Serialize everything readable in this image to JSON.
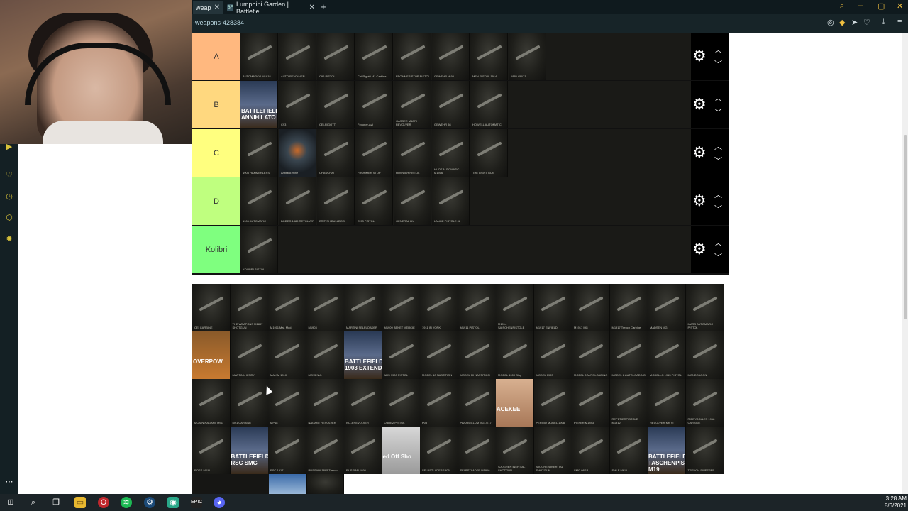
{
  "browser": {
    "tabs": [
      {
        "label": "weap",
        "close": "✕"
      },
      {
        "label": "Lumphini Garden | Battlefie",
        "close": "✕",
        "favicon": "BF"
      }
    ],
    "new_tab": "+",
    "url": "-weapons-428384"
  },
  "tiers": [
    {
      "label": "A",
      "color": "#ffb87f",
      "items": [
        {
          "tag": "AUTOMATICO M1918"
        },
        {
          "tag": "AUTO REVOLVER"
        },
        {
          "tag": "C96 PISTOL"
        },
        {
          "tag": "Cei-Rigotti M1 Carbine"
        },
        {
          "tag": "FROMMER STOP PISTOL"
        },
        {
          "tag": "GEWEHR M.95"
        },
        {
          "tag": "MEN-PISTOL 1914"
        },
        {
          "tag": "1885 GR/71"
        }
      ]
    },
    {
      "label": "B",
      "color": "#ffd87f",
      "items": [
        {
          "tag": "",
          "special": "BATTLEFIELD ANNIHILATO"
        },
        {
          "tag": "C93"
        },
        {
          "tag": "CEI-RIGOTTI"
        },
        {
          "tag": "Fedorov-Avt"
        },
        {
          "tag": "GASSER M1870 REVOLVER"
        },
        {
          "tag": "GEWEHR 98"
        },
        {
          "tag": "HOWELL AUTOMATIC"
        }
      ]
    },
    {
      "label": "C",
      "color": "#ffff7f",
      "items": [
        {
          "tag": "1903 HAMMERLESS"
        },
        {
          "tag": "Antitank mine"
        },
        {
          "tag": "CHAUCHAT"
        },
        {
          "tag": "FROMMER STOP"
        },
        {
          "tag": "HOWDAH PISTOL"
        },
        {
          "tag": "HUOT AUTOMATIC M1916"
        },
        {
          "tag": "THE LIGHT GUN"
        }
      ]
    },
    {
      "label": "D",
      "color": "#bfff7f",
      "items": [
        {
          "tag": "1906 AUTOMATIC"
        },
        {
          "tag": "BODEO 1889 REVOLVER"
        },
        {
          "tag": "BRITISH BULLDOG"
        },
        {
          "tag": "C-93 PISTOL"
        },
        {
          "tag": "GENERAL LIU"
        },
        {
          "tag": "LANGE PISTOLE 08"
        }
      ]
    },
    {
      "label": "Kolibri",
      "color": "#7fff7f",
      "items": [
        {
          "tag": "KOLIBRI PISTOL"
        }
      ]
    }
  ],
  "pool": {
    "rows": [
      [
        {
          "tag": "CEI CARBINE"
        },
        {
          "tag": "THE WEAPONS M1897 SHOTGUN"
        },
        {
          "tag": "M1911 Mal. Mod."
        },
        {
          "tag": "M1903"
        },
        {
          "tag": "MARTINI SELFLOADER"
        },
        {
          "tag": "M1909 BENET MERCIE"
        },
        {
          "tag": "1911 IN YORK"
        },
        {
          "tag": "M1911 PISTOL"
        },
        {
          "tag": "M1914 SAISCHENPISTOLE"
        },
        {
          "tag": "M1917 ENFIELD"
        },
        {
          "tag": "M1917 MG"
        },
        {
          "tag": "M1917 Trench Carbine"
        },
        {
          "tag": "MADSEN MG"
        },
        {
          "tag": "MARS AUTOMATIC PISTOL"
        }
      ],
      [
        {
          "tag": "",
          "special": "OVERPOW"
        },
        {
          "tag": "MARTINI-HENRY"
        },
        {
          "tag": "MAXIM 1910"
        },
        {
          "tag": "MG15 N.A."
        },
        {
          "tag": "",
          "special": "BATTLEFIELD 1903 EXTEND"
        },
        {
          "tag": "ARS 1900 PISTOL"
        },
        {
          "tag": "MODEL 10 NASTITION"
        },
        {
          "tag": "MODEL 10 NASTITION"
        },
        {
          "tag": "MODEL 1900 Slug"
        },
        {
          "tag": "MODEL 1903"
        },
        {
          "tag": "MODEL 8 AUTOLOADING"
        },
        {
          "tag": "MODEL 8 AUTOLOADING"
        },
        {
          "tag": "MODELLO 1915 PISTOL"
        },
        {
          "tag": "MONDRAGON"
        }
      ],
      [
        {
          "tag": "MOSIN-NAGANT M91"
        },
        {
          "tag": "M91 CARBINE"
        },
        {
          "tag": "MP18"
        },
        {
          "tag": "NAGANT REVOLVER"
        },
        {
          "tag": "NO.3 REVOLVER"
        },
        {
          "tag": "OBREZ PISTOL"
        },
        {
          "tag": "P08"
        },
        {
          "tag": "PARABELLUM MG14/17"
        },
        {
          "tag": "",
          "special": "ACEKEE"
        },
        {
          "tag": "PERINO MODEL 1908"
        },
        {
          "tag": "PIEPER M1893"
        },
        {
          "tag": "REPETIERPISTOLE M1912"
        },
        {
          "tag": "REVOLVER MK VI"
        },
        {
          "tag": "RIBEYROLLES 1918 CARBINE"
        }
      ],
      [
        {
          "tag": "ROSS MKIII"
        },
        {
          "tag": "",
          "special": "BATTLEFIELD RSC SMG"
        },
        {
          "tag": "RSC 1917"
        },
        {
          "tag": "RUSSIAN 1895 Trench"
        },
        {
          "tag": "RUSSIAN 1895"
        },
        {
          "tag": "",
          "special": "ed Off Sho"
        },
        {
          "tag": "SELBSTLADER 1906"
        },
        {
          "tag": "SELBSTLADER M1916"
        },
        {
          "tag": "SJOGREN INERTIAL SHOTGUN"
        },
        {
          "tag": "SJOGREN INERTIAL SHOTGUN"
        },
        {
          "tag": "SMG 08/18"
        },
        {
          "tag": "SMLE MKIII"
        },
        {
          "tag": "",
          "special": "BATTLEFIELD TASCHENPISTOLE M19"
        },
        {
          "tag": "TRENCH SWEEPER"
        }
      ]
    ]
  },
  "taskbar": {
    "icons": [
      "windows-icon",
      "search-icon",
      "task-view-icon",
      "file-explorer-icon",
      "opera-icon",
      "spotify-icon",
      "steam-icon",
      "obs-icon",
      "epic-games-icon",
      "discord-icon"
    ],
    "time": "3:28 AM",
    "date": "8/6/2021"
  }
}
